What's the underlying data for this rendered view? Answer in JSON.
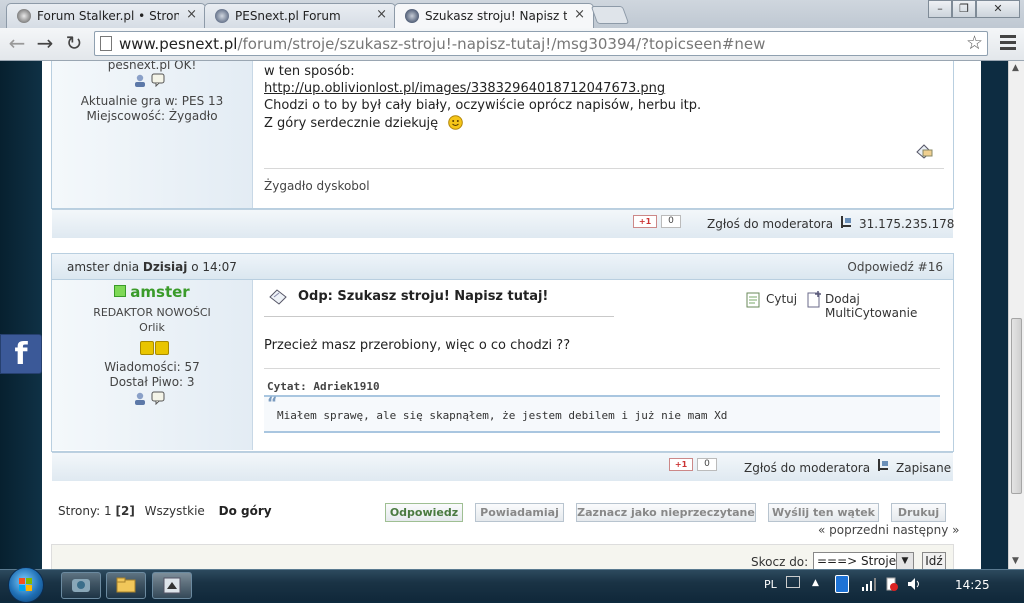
{
  "browser": {
    "tabs": [
      {
        "title": "Forum Stalker.pl • Strona g",
        "active": false,
        "color": "#1d2c4a"
      },
      {
        "title": "PESnext.pl Forum",
        "active": false,
        "color": "#2b3b5b"
      },
      {
        "title": "Szukasz stroju! Napisz tuta",
        "active": true,
        "color": "#1f2f4e"
      }
    ],
    "tab_close": "×",
    "window_controls": {
      "minimize": "–",
      "maximize": "❐",
      "close": "✕"
    },
    "url_host": "www.pesnext.pl",
    "url_path": "/forum/stroje/szukasz-stroju!-napisz-tutaj!/msg30394/?topicseen#new",
    "nav": {
      "back": "←",
      "forward": "→",
      "reload": "↻"
    },
    "star": "☆"
  },
  "post1": {
    "poster": {
      "status": "pesnext.pl OK!",
      "game_label": "Aktualnie gra w: PES 13",
      "city_label": "Miejscowość: Żygadło"
    },
    "lines": [
      "w ten sposób:",
      "http://up.oblivionlost.pl/images/33832964018712047673.png",
      "Chodzi o to by był cały biały, oczywiście oprócz napisów, herbu itp.",
      "Z góry serdecznie dziekuję"
    ],
    "signature": "Żygadło dyskobol",
    "footer": {
      "plus_one": "+1",
      "count": "0",
      "report": "Zgłoś do moderatora",
      "ip": "31.175.235.178"
    }
  },
  "post2": {
    "header": {
      "author_prefix": "amster dnia ",
      "day": "Dzisiaj",
      "time_suffix": " o 14:07",
      "reply_num": "Odpowiedź #16"
    },
    "poster": {
      "name": "amster",
      "role": "REDAKTOR NOWOŚCI",
      "rank": "Orlik",
      "messages": "Wiadomości: 57",
      "beer": "Dostał Piwo: 3"
    },
    "subject": "Odp: Szukasz stroju! Napisz tutaj!",
    "quote_btn": "Cytuj",
    "multiquote_btn": "Dodaj MultiCytowanie",
    "body": "Przecież masz przerobiony, więc o co chodzi ??",
    "quote_header": "Cytat: Adriek1910",
    "quote_mark": "“",
    "quote_text": "Miałem sprawę, ale się skapnąłem, że jestem debilem i już nie mam Xd",
    "footer": {
      "plus_one": "+1",
      "count": "0",
      "report": "Zgłoś do moderatora",
      "saved": "Zapisane"
    }
  },
  "pagination": {
    "label": "Strony: 1 ",
    "current": "[2]",
    "all": "Wszystkie",
    "top": "Do góry"
  },
  "actions": {
    "reply": "Odpowiedz",
    "notify": "Powiadamiaj",
    "mark_unread": "Zaznacz jako nieprzeczytane",
    "send_topic": "Wyślij ten wątek",
    "print": "Drukuj"
  },
  "prevnext": "« poprzedni następny »",
  "jump": {
    "label": "Skocz do:",
    "selected": "===> Stroje",
    "go": "Idź"
  },
  "facebook": "f",
  "taskbar": {
    "lang": "PL",
    "clock": "14:25"
  }
}
